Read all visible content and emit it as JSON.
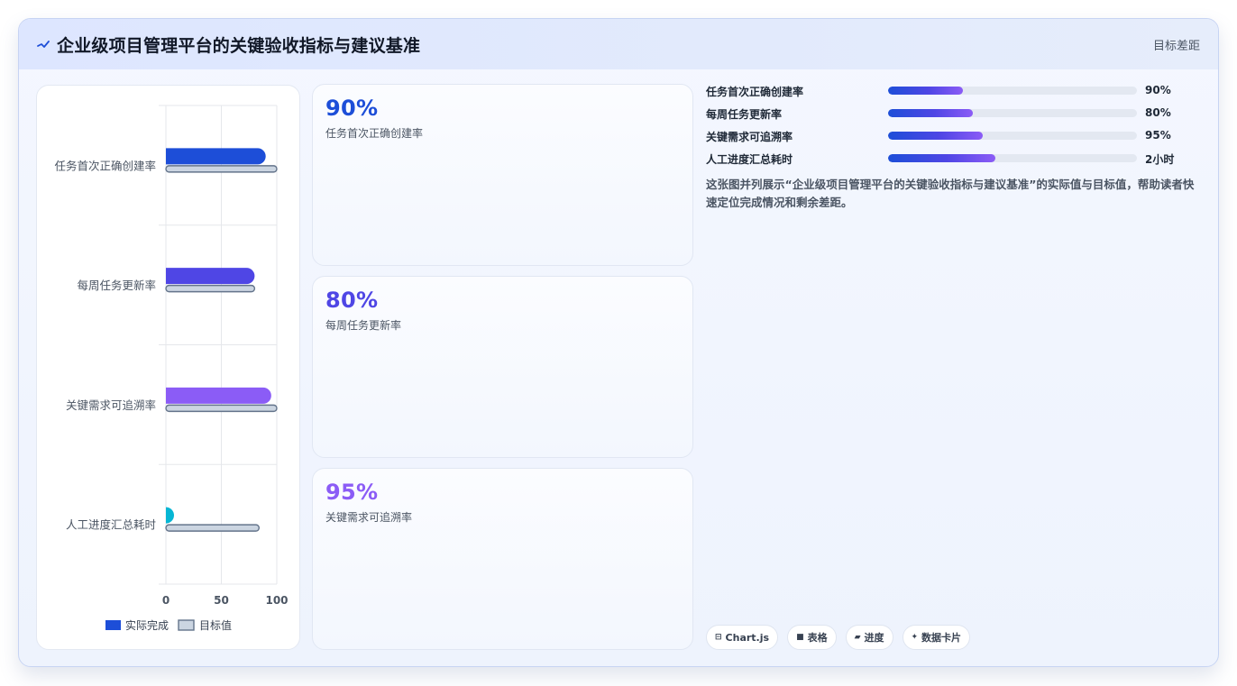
{
  "header": {
    "title": "企业级项目管理平台的关键验收指标与建议基准",
    "right_label": "目标差距",
    "icon": "pulse-icon"
  },
  "chart_data": {
    "type": "bar",
    "orientation": "horizontal",
    "categories": [
      "任务首次正确创建率",
      "每周任务更新率",
      "关键需求可追溯率",
      "人工进度汇总耗时"
    ],
    "series": [
      {
        "name": "实际完成",
        "values": [
          90,
          80,
          95,
          5
        ],
        "colors": [
          "#1d4ed8",
          "#4f46e5",
          "#8b5cf6",
          "#06b6d4"
        ]
      },
      {
        "name": "目标值",
        "values": [
          100,
          80,
          100,
          84
        ],
        "color": "#cbd5e1",
        "border": "#64748b"
      }
    ],
    "xlim": [
      0,
      100
    ],
    "xticks": [
      "0",
      "50",
      "100"
    ],
    "legend_position": "bottom",
    "grid": true
  },
  "metrics": [
    {
      "value": "90%",
      "label": "任务首次正确创建率",
      "color": "#1d4ed8"
    },
    {
      "value": "80%",
      "label": "每周任务更新率",
      "color": "#4f46e5"
    },
    {
      "value": "95%",
      "label": "关键需求可追溯率",
      "color": "#8b5cf6"
    }
  ],
  "progress": [
    {
      "name": "任务首次正确创建率",
      "value": "90%",
      "fill": 0.3
    },
    {
      "name": "每周任务更新率",
      "value": "80%",
      "fill": 0.34
    },
    {
      "name": "关键需求可追溯率",
      "value": "95%",
      "fill": 0.38
    },
    {
      "name": "人工进度汇总耗时",
      "value": "2小时",
      "fill": 0.43
    }
  ],
  "description": "这张图并列展示“企业级项目管理平台的关键验收指标与建议基准”的实际值与目标值，帮助读者快速定位完成情况和剩余差距。",
  "tags": [
    {
      "label": "Chart.js",
      "icon": "chart-icon",
      "glyph": "⊟"
    },
    {
      "label": "表格",
      "icon": "table-icon",
      "glyph": "■"
    },
    {
      "label": "进度",
      "icon": "progress-icon",
      "glyph": "▰"
    },
    {
      "label": "数据卡片",
      "icon": "sparkle-icon",
      "glyph": "✦"
    }
  ]
}
